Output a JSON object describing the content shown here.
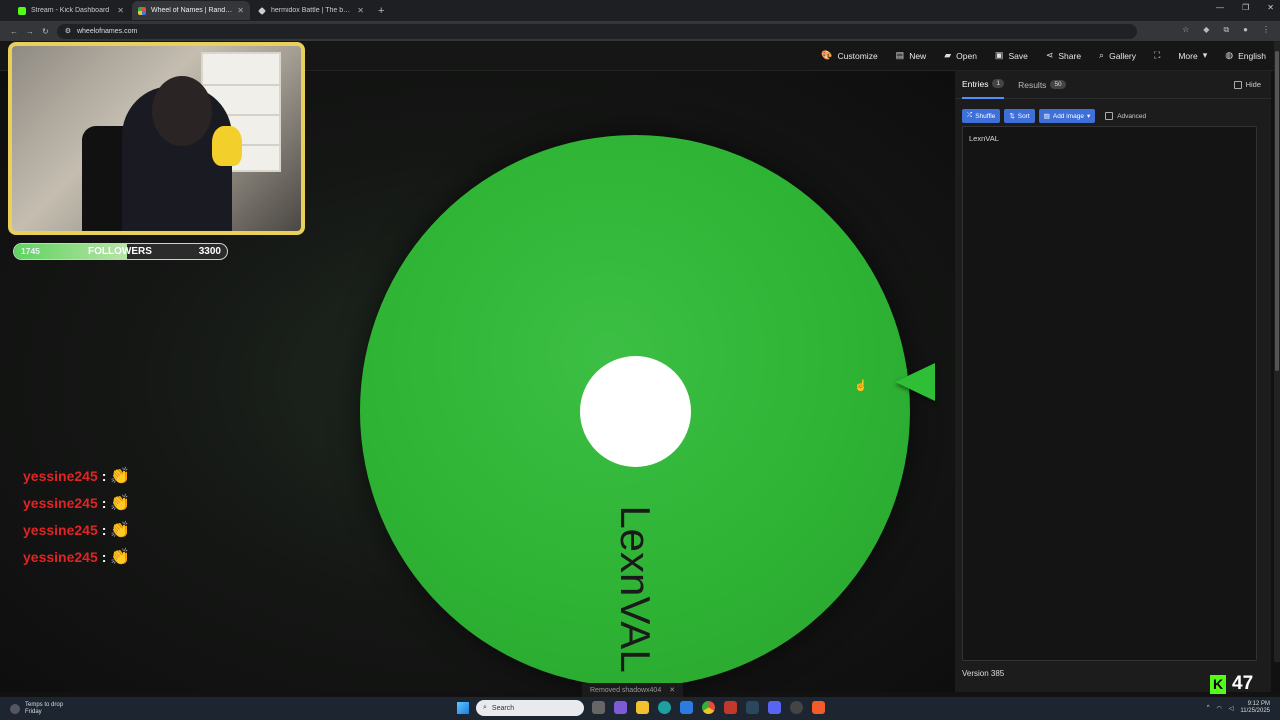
{
  "browser": {
    "tabs": [
      {
        "title": "Stream - Kick Dashboard",
        "favicon_color": "#53fc18"
      },
      {
        "title": "Wheel of Names | Random nam",
        "favicon_color": "#e84a3b"
      },
      {
        "title": "hermidox Battle | The best Chr",
        "favicon_color": "#cccccc"
      }
    ],
    "new_tab_symbol": "+",
    "url": "wheelofnames.com"
  },
  "toolbar": {
    "customize": "Customize",
    "new": "New",
    "open": "Open",
    "save": "Save",
    "share": "Share",
    "gallery": "Gallery",
    "more": "More",
    "language": "English"
  },
  "wheel": {
    "entry_label": "LexnVAL",
    "slice_color": "#2eb334"
  },
  "panel": {
    "entries_tab": "Entries",
    "entries_count": "1",
    "results_tab": "Results",
    "results_count": "50",
    "hide_label": "Hide",
    "shuffle": "Shuffle",
    "sort": "Sort",
    "add_image": "Add image",
    "advanced": "Advanced",
    "entries_text": "LexnVAL",
    "version": "Version 385"
  },
  "overlay": {
    "followers_current": "1745",
    "followers_label": "FOLLOWERS",
    "followers_goal": "3300",
    "followers_progress": 0.53,
    "chat": [
      {
        "user": "yessine245",
        "sep": ":"
      },
      {
        "user": "yessine245",
        "sep": ":"
      },
      {
        "user": "yessine245",
        "sep": ":"
      },
      {
        "user": "yessine245",
        "sep": ":"
      }
    ],
    "toast": "Removed shadowx404",
    "viewer_count": "47"
  },
  "taskbar": {
    "weather_line1": "Temps to drop",
    "weather_line2": "Friday",
    "search_placeholder": "Search",
    "time": "9:12 PM",
    "date": "11/25/2025"
  }
}
